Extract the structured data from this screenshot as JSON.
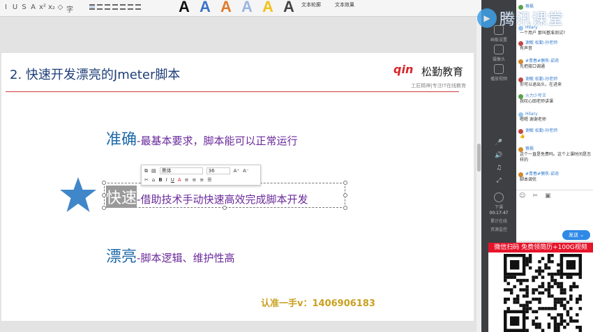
{
  "ribbon": {
    "format_buttons": [
      "I",
      "U",
      "S",
      "A",
      "x²",
      "x₂",
      "◇",
      "字"
    ],
    "text_style_samples": [
      "A",
      "A",
      "A",
      "A",
      "A",
      "A"
    ],
    "text_style_colors": [
      "#111111",
      "#3a72c8",
      "#e07a2a",
      "#9ab6e0",
      "#f2c21b",
      "#444444"
    ],
    "text_outline_label": "文本轮廓",
    "text_effect_label": "文本效果"
  },
  "slide": {
    "title": "2. 快速开发漂亮的Jmeter脚本",
    "logo_mark": "qin",
    "logo_text": "松勤教育",
    "logo_slogan": "工匠精神|专注IT在线教育",
    "items": [
      {
        "keyword": "准确",
        "dash": "-",
        "text": "最基本要求，脚本能可以正常运行"
      },
      {
        "keyword": "快速",
        "dash": "-",
        "text": "借助技术手动快速高效完成脚本开发"
      },
      {
        "keyword": "漂亮",
        "dash": "-",
        "text": "脚本逻辑、维护性高"
      }
    ],
    "contact": "认准一手v：1406906183"
  },
  "mini_toolbar": {
    "font_name": "黑体",
    "font_size": "36",
    "grow": "A⁺",
    "shrink": "A⁻",
    "buttons": [
      "B",
      "I",
      "U",
      "A"
    ]
  },
  "watermark": {
    "text": "腾讯课堂"
  },
  "strip": {
    "items": [
      "画板设置",
      "摄像头",
      "播放视频",
      "讨论区"
    ],
    "download": "下课",
    "timer": "00:17:47",
    "timer_label": "累计在线",
    "resource": "资源监控"
  },
  "chat": {
    "messages": [
      {
        "name": "蔡枫",
        "text": "…",
        "badge": "g"
      },
      {
        "name": "Hilary",
        "text": "一个用户 那叫基准测试?",
        "badge": ""
      },
      {
        "name": "谢敏 松勤-孙老师",
        "text": "有声音",
        "badge": "r"
      },
      {
        "name": "#青春#懒佚-茹奇",
        "text": "先把接口调通",
        "badge": "b"
      },
      {
        "name": "谢敏 松勤-孙老师",
        "text": "你可以退出头，在进来",
        "badge": "r"
      },
      {
        "name": "火力少年王",
        "text": "我叹心田老师讲课",
        "badge": "g"
      },
      {
        "name": "Hilary",
        "text": "嗯嗯 谢谢老师",
        "badge": ""
      },
      {
        "name": "谢敏 松勤-孙老师",
        "text": "👍",
        "badge": "r"
      },
      {
        "name": "蔡枫",
        "text": "这个一直是免费吗。这个上课时间是怎样的",
        "badge": "b"
      },
      {
        "name": "#青春#懒佚-茹奇",
        "text": "脚本调优",
        "badge": "b"
      }
    ],
    "send_label": "发送"
  },
  "ad": {
    "banner": "微信扫码 免费领简历+100G视频"
  }
}
